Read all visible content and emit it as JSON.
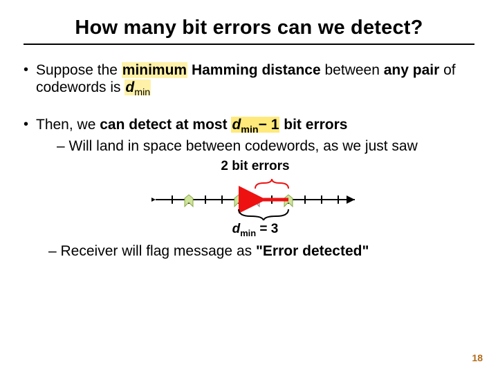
{
  "title": "How many bit errors can we detect?",
  "bullets": [
    {
      "pre": "Suppose the ",
      "hl": "minimum",
      "mid1": " Hamming distance",
      "mid2": " between ",
      "mid3": "any pair",
      "mid4": " of codewords is ",
      "dvar": "d",
      "dsub": "min"
    },
    {
      "pre": "Then, we ",
      "b1": "can detect at most",
      "sp": " ",
      "dvar": "d",
      "dsub": "min",
      "hl_m": "− 1",
      "b2": " bit errors",
      "sub1": "Will land in space between codewords, as we just saw",
      "sub2a": "Receiver will flag message as ",
      "sub2b": "\"Error detected\""
    }
  ],
  "figure": {
    "top_label": "2 bit errors",
    "bot_prefix": "d",
    "bot_sub": "min",
    "bot_rest": " = 3"
  },
  "pageno": "18"
}
